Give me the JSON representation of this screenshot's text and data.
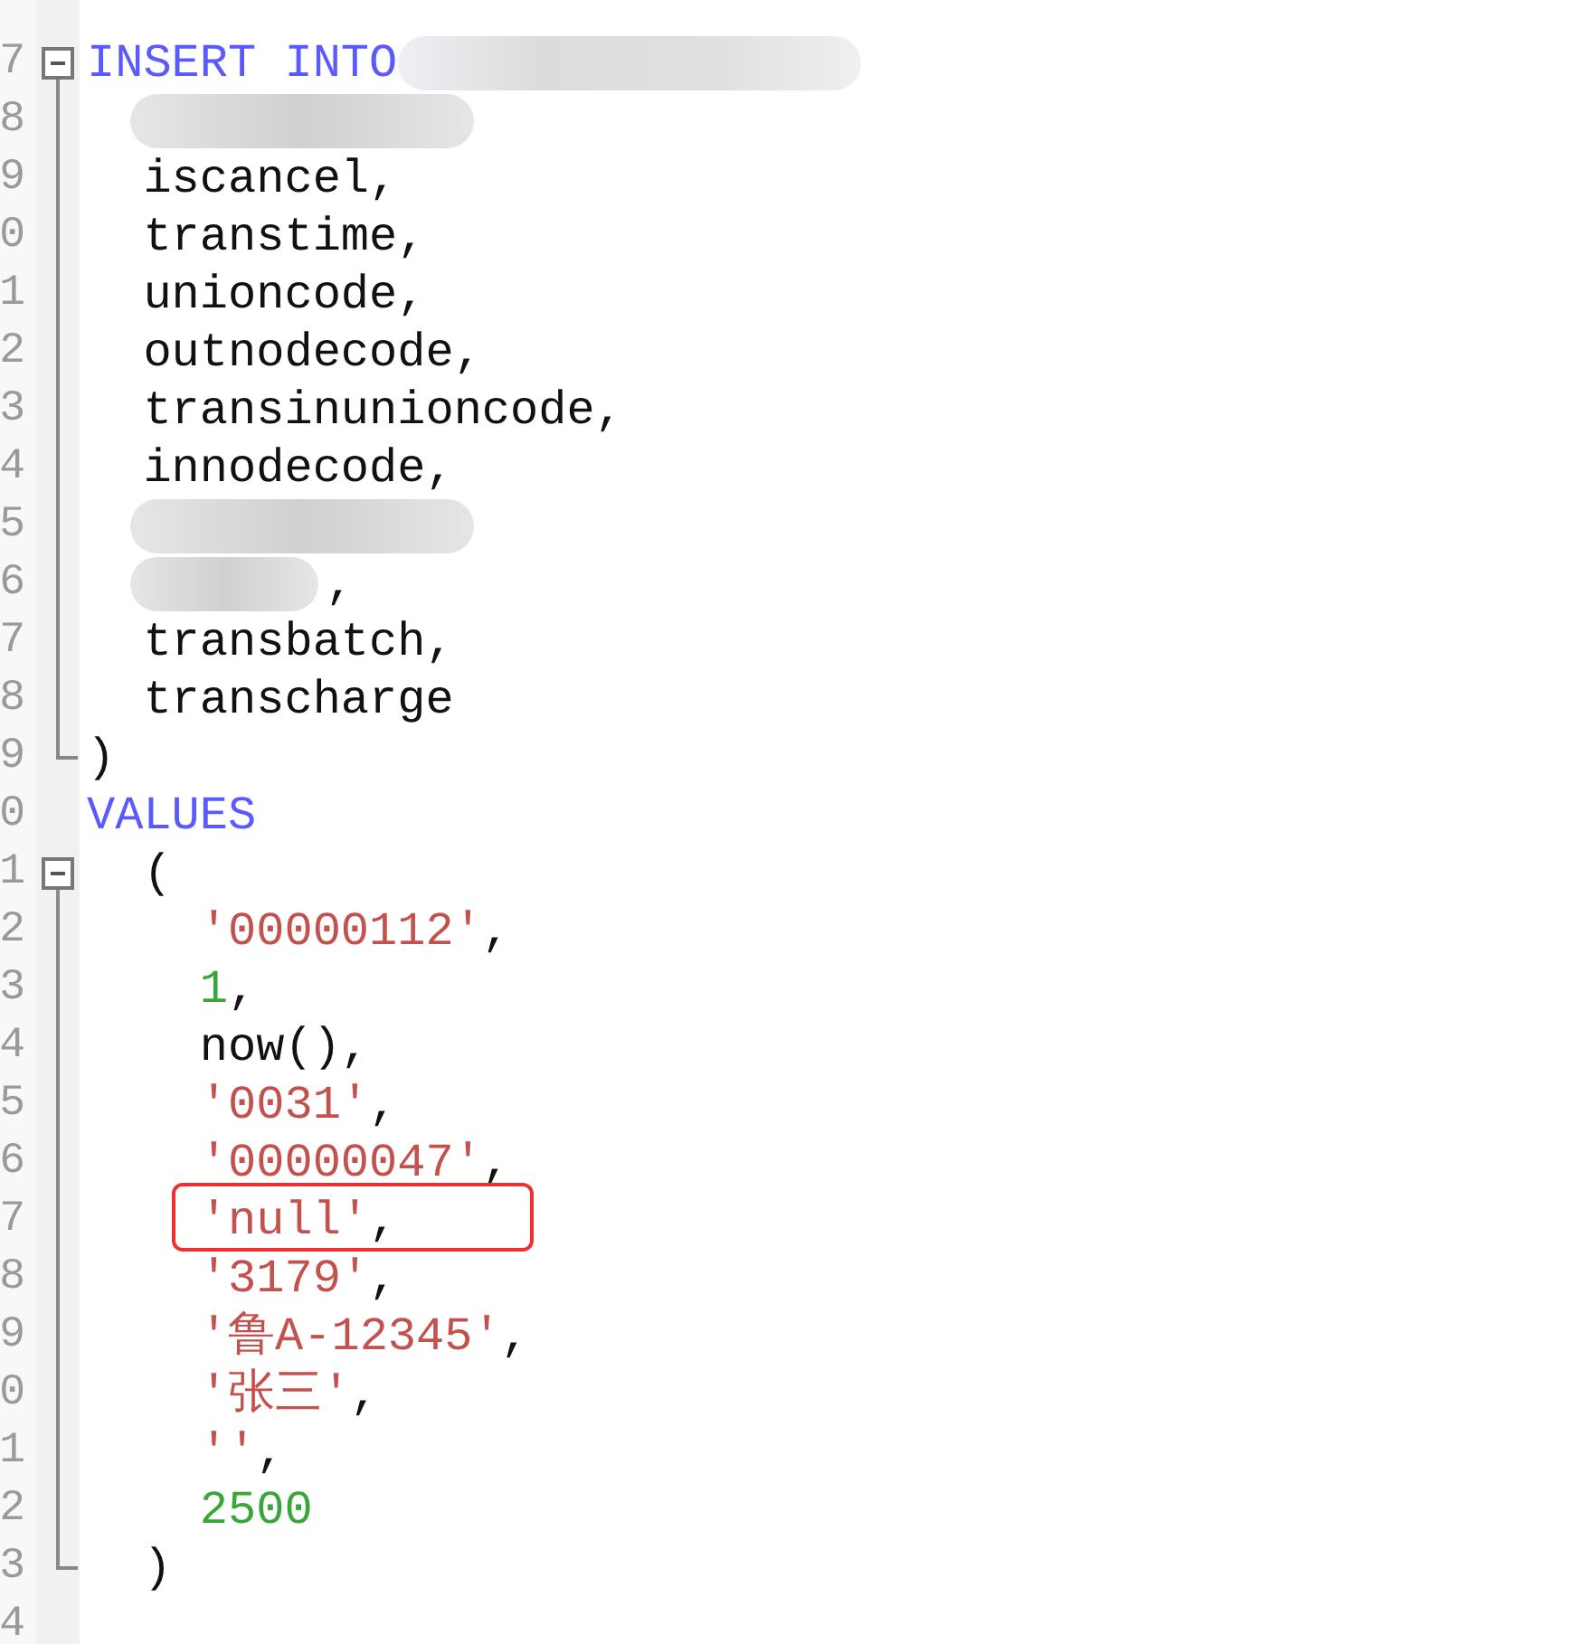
{
  "editor": {
    "lines": [
      {
        "number": "7",
        "expanded": true,
        "blur_after": true,
        "tokens": [
          {
            "kind": "keyword",
            "text": "INSERT INTO"
          }
        ],
        "children": [
          {
            "number": "8",
            "blur_before": true
          },
          {
            "number": "9",
            "tokens": [
              {
                "kind": "plain",
                "text": "  iscancel,"
              }
            ]
          },
          {
            "number": "0",
            "tokens": [
              {
                "kind": "plain",
                "text": "  transtime,"
              }
            ]
          },
          {
            "number": "1",
            "tokens": [
              {
                "kind": "plain",
                "text": "  unioncode,"
              }
            ]
          },
          {
            "number": "2",
            "tokens": [
              {
                "kind": "plain",
                "text": "  outnodecode,"
              }
            ]
          },
          {
            "number": "3",
            "tokens": [
              {
                "kind": "plain",
                "text": "  transinunioncode,"
              }
            ]
          },
          {
            "number": "4",
            "tokens": [
              {
                "kind": "plain",
                "text": "  innodecode,"
              }
            ]
          },
          {
            "number": "5",
            "blur_before": true
          },
          {
            "number": "6",
            "blur_before": true,
            "tokens": [
              {
                "kind": "plain",
                "text": ","
              }
            ]
          },
          {
            "number": "7",
            "tokens": [
              {
                "kind": "plain",
                "text": "  transbatch,"
              }
            ]
          },
          {
            "number": "8",
            "tokens": [
              {
                "kind": "plain",
                "text": "  transcharge"
              }
            ]
          },
          {
            "number": "9",
            "tokens": [
              {
                "kind": "plain",
                "text": ")"
              }
            ]
          }
        ]
      },
      {
        "number": "0",
        "tokens": [
          {
            "kind": "keyword",
            "text": "VALUES"
          }
        ]
      },
      {
        "number": "1",
        "expanded": true,
        "tokens": [
          {
            "kind": "plain",
            "text": "  ("
          }
        ],
        "children": [
          {
            "number": "2",
            "tokens": [
              {
                "kind": "string",
                "text": "    '00000112'"
              },
              {
                "kind": "plain",
                "text": ","
              }
            ]
          },
          {
            "number": "3",
            "tokens": [
              {
                "kind": "number",
                "text": "    1"
              },
              {
                "kind": "plain",
                "text": ","
              }
            ]
          },
          {
            "number": "4",
            "tokens": [
              {
                "kind": "plain",
                "text": "    now(),"
              }
            ]
          },
          {
            "number": "5",
            "tokens": [
              {
                "kind": "string",
                "text": "    '0031'"
              },
              {
                "kind": "plain",
                "text": ","
              }
            ]
          },
          {
            "number": "6",
            "tokens": [
              {
                "kind": "string",
                "text": "    '00000047'"
              },
              {
                "kind": "plain",
                "text": ","
              }
            ]
          },
          {
            "number": "7",
            "highlighted": true,
            "tokens": [
              {
                "kind": "string",
                "text": "    'null'"
              },
              {
                "kind": "plain",
                "text": ","
              }
            ]
          },
          {
            "number": "8",
            "tokens": [
              {
                "kind": "string",
                "text": "    '3179'"
              },
              {
                "kind": "plain",
                "text": ","
              }
            ]
          },
          {
            "number": "9",
            "tokens": [
              {
                "kind": "string",
                "text": "    '鲁A-12345'"
              },
              {
                "kind": "plain",
                "text": ","
              }
            ]
          },
          {
            "number": "0",
            "tokens": [
              {
                "kind": "string",
                "text": "    '张三'"
              },
              {
                "kind": "plain",
                "text": ","
              }
            ]
          },
          {
            "number": "1",
            "tokens": [
              {
                "kind": "string",
                "text": "    ''"
              },
              {
                "kind": "plain",
                "text": ","
              }
            ]
          },
          {
            "number": "2",
            "tokens": [
              {
                "kind": "number",
                "text": "    2500"
              }
            ]
          },
          {
            "number": "3",
            "tokens": [
              {
                "kind": "plain",
                "text": "  )"
              }
            ]
          }
        ]
      },
      {
        "number": "4"
      }
    ]
  }
}
